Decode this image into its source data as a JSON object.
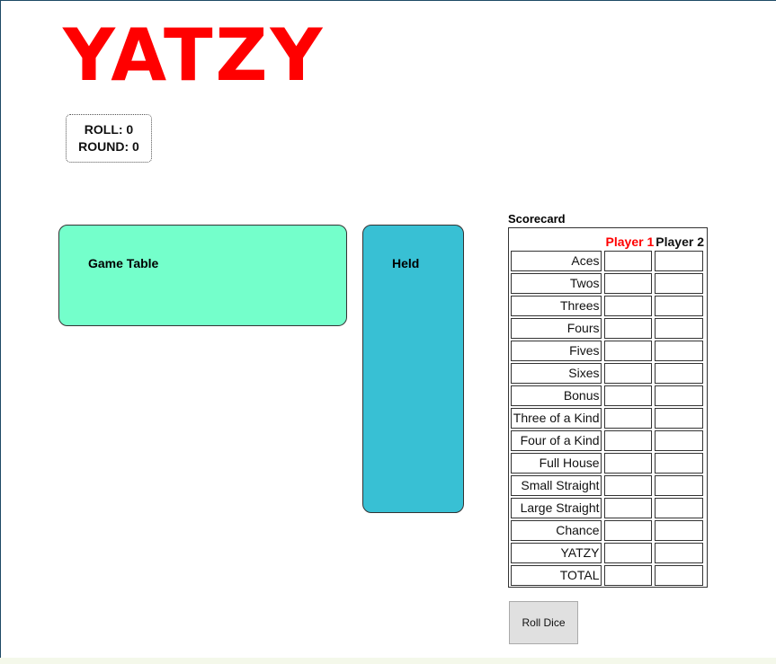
{
  "title": "YATZY",
  "status": {
    "roll": "ROLL: 0",
    "round": "ROUND: 0"
  },
  "game_table": {
    "label": "Game Table"
  },
  "held": {
    "label": "Held"
  },
  "scorecard": {
    "title": "Scorecard",
    "players": [
      "Player 1",
      "Player 2"
    ],
    "rows": [
      "Aces",
      "Twos",
      "Threes",
      "Fours",
      "Fives",
      "Sixes",
      "Bonus",
      "Three of a Kind",
      "Four of a Kind",
      "Full House",
      "Small Straight",
      "Large Straight",
      "Chance",
      "YATZY",
      "TOTAL"
    ]
  },
  "roll_button": {
    "label": "Roll Dice"
  },
  "colors": {
    "title": "#ff0000",
    "game_table": "#74ffcb",
    "held": "#38c0d4",
    "player1": "#ff0000"
  }
}
